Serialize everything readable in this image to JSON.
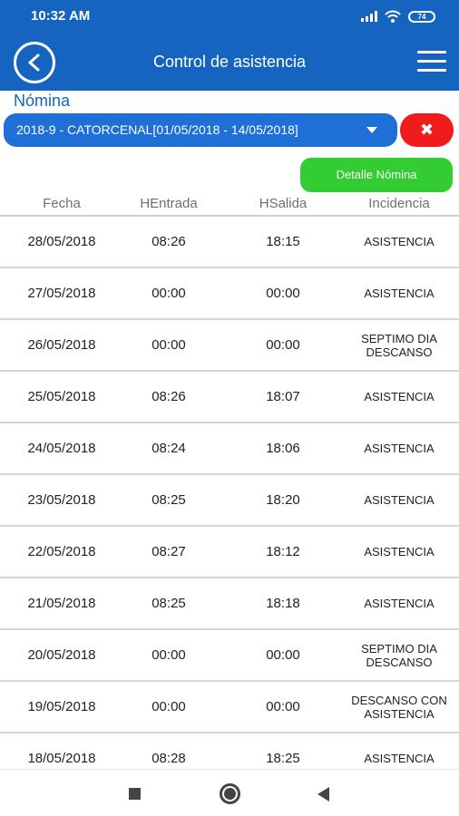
{
  "status_bar": {
    "time": "10:32 AM",
    "battery": "74",
    "icons": [
      "signal-icon",
      "wifi-icon",
      "battery-icon"
    ]
  },
  "app_bar": {
    "title": "Control de asistencia",
    "back_icon": "back-arrow-icon",
    "menu_icon": "hamburger-menu-icon"
  },
  "nomina": {
    "label": "Nómina",
    "selected": "2018-9 - CATORCENAL[01/05/2018 - 14/05/2018]",
    "clear_icon": "✖",
    "detail_button": "Detalle Nómina"
  },
  "table": {
    "headers": [
      "Fecha",
      "HEntrada",
      "HSalida",
      "Incidencia"
    ],
    "rows": [
      {
        "fecha": "28/05/2018",
        "entrada": "08:26",
        "salida": "18:15",
        "incidencia": "ASISTENCIA"
      },
      {
        "fecha": "27/05/2018",
        "entrada": "00:00",
        "salida": "00:00",
        "incidencia": "ASISTENCIA"
      },
      {
        "fecha": "26/05/2018",
        "entrada": "00:00",
        "salida": "00:00",
        "incidencia": "SEPTIMO DIA DESCANSO"
      },
      {
        "fecha": "25/05/2018",
        "entrada": "08:26",
        "salida": "18:07",
        "incidencia": "ASISTENCIA"
      },
      {
        "fecha": "24/05/2018",
        "entrada": "08:24",
        "salida": "18:06",
        "incidencia": "ASISTENCIA"
      },
      {
        "fecha": "23/05/2018",
        "entrada": "08:25",
        "salida": "18:20",
        "incidencia": "ASISTENCIA"
      },
      {
        "fecha": "22/05/2018",
        "entrada": "08:27",
        "salida": "18:12",
        "incidencia": "ASISTENCIA"
      },
      {
        "fecha": "21/05/2018",
        "entrada": "08:25",
        "salida": "18:18",
        "incidencia": "ASISTENCIA"
      },
      {
        "fecha": "20/05/2018",
        "entrada": "00:00",
        "salida": "00:00",
        "incidencia": "SEPTIMO DIA DESCANSO"
      },
      {
        "fecha": "19/05/2018",
        "entrada": "00:00",
        "salida": "00:00",
        "incidencia": "DESCANSO CON ASISTENCIA"
      },
      {
        "fecha": "18/05/2018",
        "entrada": "08:28",
        "salida": "18:25",
        "incidencia": "ASISTENCIA"
      }
    ]
  },
  "nav_bar": {
    "icons": [
      "recents-icon",
      "home-icon",
      "back-icon"
    ]
  },
  "colors": {
    "primary": "#1565c0",
    "select": "#1e6fd6",
    "danger": "#f01c1c",
    "success": "#33cc33"
  }
}
